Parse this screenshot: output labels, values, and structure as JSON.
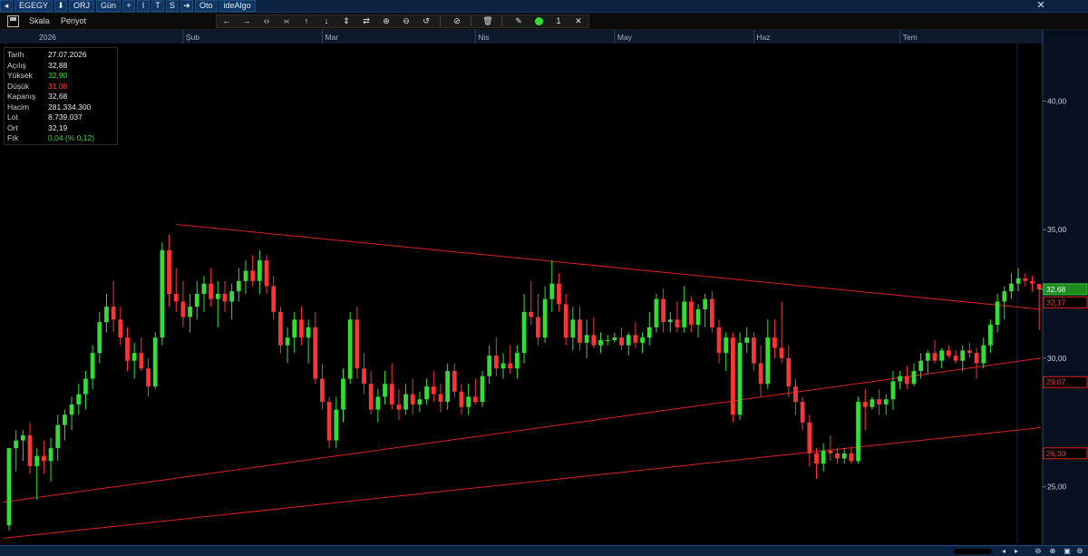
{
  "titlebar": {
    "symbol": "EGEGY",
    "orj": "ORJ",
    "period": "Gün",
    "btn_i": "I",
    "btn_t": "T",
    "btn_s": "S",
    "oto": "Oto",
    "idealgo": "ideAlgo"
  },
  "toolbar": {
    "scale": "Skala",
    "period": "Periyot",
    "line_count": "1"
  },
  "icons": {
    "close": "close-icon",
    "save": "save-icon",
    "arrow_left": "arrow-left-icon",
    "arrow_right": "arrow-right-icon",
    "zoom_in": "zoom-in-icon",
    "zoom_out": "zoom-out-icon",
    "refresh": "refresh-icon",
    "trash": "trash-icon",
    "pen": "pen-icon"
  },
  "info": {
    "rows": [
      {
        "label": "Tarih",
        "value": "27.07.2026",
        "tone": "neutral"
      },
      {
        "label": "Açılış",
        "value": "32,88",
        "tone": "neutral"
      },
      {
        "label": "Yüksek",
        "value": "32,90",
        "tone": "up"
      },
      {
        "label": "Düşük",
        "value": "31,08",
        "tone": "down"
      },
      {
        "label": "Kapanış",
        "value": "32,68",
        "tone": "neutral"
      },
      {
        "label": "Hacim",
        "value": "281.334.300",
        "tone": "neutral"
      },
      {
        "label": "Lot",
        "value": "8.739.037",
        "tone": "neutral"
      },
      {
        "label": "Ort",
        "value": "32,19",
        "tone": "neutral"
      },
      {
        "label": "Frk",
        "value": "0,04 (% 0,12)",
        "tone": "up"
      }
    ]
  },
  "colors": {
    "up": "#33dd33",
    "down": "#ff3333",
    "trend": "#e02020",
    "last_price_line": "#33cc33",
    "background": "#000000"
  },
  "chart_data": {
    "type": "candlestick",
    "y_ticks": [
      "40,00",
      "35,00",
      "30,00",
      "25,00"
    ],
    "y_tick_values": [
      40,
      35,
      30,
      25
    ],
    "ylim": [
      22.8,
      42.2
    ],
    "x_months": [
      {
        "label": "2026",
        "index": 0
      },
      {
        "label": "Şub",
        "index": 25
      },
      {
        "label": "Mar",
        "index": 45
      },
      {
        "label": "Nis",
        "index": 67
      },
      {
        "label": "May",
        "index": 87
      },
      {
        "label": "Haz",
        "index": 107
      },
      {
        "label": "Tem",
        "index": 128
      }
    ],
    "price_tags": [
      {
        "label": "32,68",
        "value": 32.68,
        "style": "last"
      },
      {
        "label": "32,17",
        "value": 32.17,
        "style": "red"
      },
      {
        "label": "29,07",
        "value": 29.07,
        "style": "red"
      },
      {
        "label": "26,30",
        "value": 26.3,
        "style": "red"
      }
    ],
    "trend_lines": [
      {
        "from": [
          24,
          35.2
        ],
        "to": [
          156,
          31.9
        ]
      },
      {
        "from": [
          0,
          24.4
        ],
        "to": [
          156,
          30.0
        ]
      },
      {
        "from": [
          0,
          23.0
        ],
        "to": [
          156,
          27.3
        ]
      }
    ],
    "candles": [
      [
        23.5,
        26.5,
        23.3,
        26.5
      ],
      [
        26.5,
        27.2,
        25.6,
        26.8
      ],
      [
        26.8,
        27.2,
        26.0,
        27.0
      ],
      [
        27.0,
        27.5,
        25.5,
        25.8
      ],
      [
        25.8,
        26.5,
        24.5,
        26.2
      ],
      [
        26.2,
        26.8,
        25.5,
        26.0
      ],
      [
        26.0,
        26.9,
        25.2,
        26.5
      ],
      [
        26.5,
        27.8,
        26.0,
        27.4
      ],
      [
        27.4,
        28.0,
        26.8,
        27.8
      ],
      [
        27.8,
        28.5,
        27.2,
        28.2
      ],
      [
        28.2,
        29.0,
        27.8,
        28.6
      ],
      [
        28.6,
        29.5,
        28.0,
        29.2
      ],
      [
        29.2,
        30.5,
        28.8,
        30.2
      ],
      [
        30.2,
        31.8,
        29.8,
        31.4
      ],
      [
        31.4,
        32.5,
        31.0,
        32.0
      ],
      [
        32.0,
        33.0,
        31.0,
        31.5
      ],
      [
        31.5,
        32.0,
        30.5,
        30.8
      ],
      [
        30.8,
        31.2,
        29.5,
        29.9
      ],
      [
        29.9,
        30.6,
        29.2,
        30.2
      ],
      [
        30.2,
        30.8,
        29.5,
        29.6
      ],
      [
        29.6,
        30.0,
        28.5,
        28.9
      ],
      [
        28.9,
        31.0,
        28.8,
        30.8
      ],
      [
        30.8,
        34.5,
        30.5,
        34.2
      ],
      [
        34.2,
        34.8,
        32.0,
        32.5
      ],
      [
        32.5,
        33.5,
        31.8,
        32.2
      ],
      [
        32.2,
        33.0,
        31.2,
        31.6
      ],
      [
        31.6,
        32.5,
        31.0,
        32.0
      ],
      [
        32.0,
        33.0,
        31.5,
        32.5
      ],
      [
        32.5,
        33.2,
        31.8,
        32.9
      ],
      [
        32.9,
        33.5,
        32.0,
        32.3
      ],
      [
        32.3,
        33.0,
        31.2,
        32.5
      ],
      [
        32.5,
        33.0,
        31.8,
        32.2
      ],
      [
        32.2,
        32.9,
        31.5,
        32.6
      ],
      [
        32.6,
        33.5,
        32.2,
        33.0
      ],
      [
        33.0,
        33.8,
        32.5,
        33.4
      ],
      [
        33.4,
        34.0,
        32.8,
        33.0
      ],
      [
        33.0,
        34.2,
        32.5,
        33.8
      ],
      [
        33.8,
        34.0,
        32.5,
        32.8
      ],
      [
        32.8,
        33.2,
        31.5,
        31.8
      ],
      [
        31.8,
        32.0,
        30.2,
        30.5
      ],
      [
        30.5,
        31.2,
        29.8,
        30.8
      ],
      [
        30.8,
        31.8,
        30.2,
        31.5
      ],
      [
        31.5,
        32.0,
        30.5,
        30.8
      ],
      [
        30.8,
        31.5,
        29.8,
        31.2
      ],
      [
        31.2,
        31.8,
        29.0,
        29.2
      ],
      [
        29.2,
        29.8,
        28.0,
        28.3
      ],
      [
        28.3,
        28.5,
        26.5,
        26.8
      ],
      [
        26.8,
        28.5,
        26.5,
        28.0
      ],
      [
        28.0,
        29.6,
        27.5,
        29.2
      ],
      [
        29.2,
        31.8,
        29.0,
        31.5
      ],
      [
        31.5,
        32.0,
        29.2,
        29.6
      ],
      [
        29.6,
        30.2,
        28.6,
        29.0
      ],
      [
        29.0,
        29.5,
        27.8,
        28.0
      ],
      [
        28.0,
        28.8,
        27.5,
        28.5
      ],
      [
        28.5,
        29.5,
        28.2,
        29.0
      ],
      [
        29.0,
        29.8,
        28.0,
        28.2
      ],
      [
        28.2,
        28.8,
        27.6,
        28.0
      ],
      [
        28.0,
        29.0,
        27.8,
        28.6
      ],
      [
        28.6,
        29.2,
        27.8,
        28.2
      ],
      [
        28.2,
        28.7,
        27.9,
        28.4
      ],
      [
        28.4,
        29.2,
        28.2,
        28.9
      ],
      [
        28.9,
        29.5,
        28.3,
        28.6
      ],
      [
        28.6,
        29.0,
        27.9,
        28.3
      ],
      [
        28.3,
        29.8,
        28.0,
        29.5
      ],
      [
        29.5,
        29.8,
        28.5,
        28.7
      ],
      [
        28.7,
        29.0,
        27.8,
        28.1
      ],
      [
        28.1,
        29.0,
        27.8,
        28.5
      ],
      [
        28.5,
        29.2,
        28.2,
        28.3
      ],
      [
        28.3,
        29.5,
        28.1,
        29.3
      ],
      [
        29.3,
        30.5,
        29.0,
        30.1
      ],
      [
        30.1,
        30.8,
        29.3,
        29.6
      ],
      [
        29.6,
        30.2,
        29.2,
        29.8
      ],
      [
        29.8,
        30.5,
        29.4,
        29.6
      ],
      [
        29.6,
        30.5,
        29.2,
        30.2
      ],
      [
        30.2,
        32.5,
        29.8,
        31.8
      ],
      [
        31.8,
        33.0,
        31.3,
        31.6
      ],
      [
        31.6,
        32.5,
        30.5,
        30.8
      ],
      [
        30.8,
        32.8,
        30.6,
        32.3
      ],
      [
        32.3,
        33.8,
        31.8,
        32.9
      ],
      [
        32.9,
        33.3,
        31.8,
        32.1
      ],
      [
        32.1,
        32.5,
        30.5,
        30.8
      ],
      [
        30.8,
        32.0,
        30.3,
        31.5
      ],
      [
        31.5,
        32.0,
        30.3,
        30.6
      ],
      [
        30.6,
        31.5,
        30.0,
        30.9
      ],
      [
        30.9,
        31.6,
        30.4,
        30.5
      ],
      [
        30.5,
        31.0,
        30.2,
        30.7
      ],
      [
        30.7,
        30.9,
        30.5,
        30.7
      ],
      [
        30.7,
        31.0,
        30.6,
        30.8
      ],
      [
        30.8,
        31.2,
        30.3,
        30.5
      ],
      [
        30.5,
        31.0,
        30.1,
        30.9
      ],
      [
        30.9,
        31.4,
        30.4,
        30.6
      ],
      [
        30.6,
        31.0,
        30.2,
        30.8
      ],
      [
        30.8,
        31.8,
        30.5,
        31.2
      ],
      [
        31.2,
        32.5,
        31.0,
        32.3
      ],
      [
        32.3,
        32.7,
        31.0,
        31.4
      ],
      [
        31.4,
        31.8,
        31.0,
        31.5
      ],
      [
        31.5,
        32.2,
        31.0,
        31.2
      ],
      [
        31.2,
        32.8,
        31.0,
        32.2
      ],
      [
        32.2,
        32.4,
        31.0,
        31.3
      ],
      [
        31.3,
        32.1,
        30.8,
        31.9
      ],
      [
        31.9,
        32.5,
        31.2,
        32.3
      ],
      [
        32.3,
        32.6,
        31.0,
        31.2
      ],
      [
        31.2,
        31.5,
        29.8,
        30.2
      ],
      [
        30.2,
        31.0,
        29.5,
        30.8
      ],
      [
        30.8,
        31.0,
        27.5,
        27.8
      ],
      [
        27.8,
        31.0,
        27.6,
        30.6
      ],
      [
        30.6,
        31.2,
        30.2,
        30.8
      ],
      [
        30.8,
        31.0,
        29.5,
        29.8
      ],
      [
        29.8,
        30.5,
        28.5,
        29.0
      ],
      [
        29.0,
        31.5,
        28.8,
        30.8
      ],
      [
        30.8,
        31.5,
        30.0,
        30.4
      ],
      [
        30.4,
        32.2,
        29.8,
        30.0
      ],
      [
        30.0,
        30.5,
        28.5,
        28.9
      ],
      [
        28.9,
        29.2,
        27.8,
        28.3
      ],
      [
        28.3,
        28.5,
        27.2,
        27.5
      ],
      [
        27.5,
        27.8,
        25.8,
        26.3
      ],
      [
        26.3,
        26.5,
        25.3,
        25.9
      ],
      [
        25.9,
        26.7,
        25.6,
        26.4
      ],
      [
        26.4,
        27.0,
        26.0,
        26.3
      ],
      [
        26.3,
        26.5,
        25.9,
        26.1
      ],
      [
        26.1,
        26.5,
        25.9,
        26.3
      ],
      [
        26.3,
        26.5,
        25.9,
        26.0
      ],
      [
        26.0,
        28.5,
        25.9,
        28.3
      ],
      [
        28.3,
        28.8,
        27.2,
        28.1
      ],
      [
        28.1,
        28.5,
        28.0,
        28.4
      ],
      [
        28.4,
        28.8,
        27.8,
        28.2
      ],
      [
        28.2,
        28.6,
        27.8,
        28.4
      ],
      [
        28.4,
        29.5,
        28.0,
        29.1
      ],
      [
        29.1,
        29.5,
        28.8,
        29.3
      ],
      [
        29.3,
        29.7,
        28.8,
        29.0
      ],
      [
        29.0,
        29.8,
        28.9,
        29.5
      ],
      [
        29.5,
        30.2,
        29.2,
        29.9
      ],
      [
        29.9,
        30.3,
        29.4,
        30.2
      ],
      [
        30.2,
        30.7,
        29.8,
        29.9
      ],
      [
        29.9,
        30.4,
        29.6,
        30.3
      ],
      [
        30.3,
        30.5,
        30.0,
        30.1
      ],
      [
        30.1,
        30.3,
        29.8,
        29.9
      ],
      [
        29.9,
        30.5,
        29.5,
        30.3
      ],
      [
        30.3,
        30.6,
        30.0,
        30.2
      ],
      [
        30.2,
        30.4,
        29.2,
        29.8
      ],
      [
        29.8,
        30.8,
        29.6,
        30.5
      ],
      [
        30.5,
        31.5,
        30.2,
        31.3
      ],
      [
        31.3,
        32.5,
        31.0,
        32.2
      ],
      [
        32.2,
        32.8,
        31.5,
        32.6
      ],
      [
        32.6,
        33.3,
        32.3,
        32.9
      ],
      [
        32.9,
        33.5,
        32.6,
        33.1
      ],
      [
        33.1,
        33.3,
        32.8,
        33.0
      ],
      [
        33.0,
        33.2,
        32.6,
        32.9
      ],
      [
        32.88,
        32.9,
        31.08,
        32.68
      ]
    ]
  }
}
